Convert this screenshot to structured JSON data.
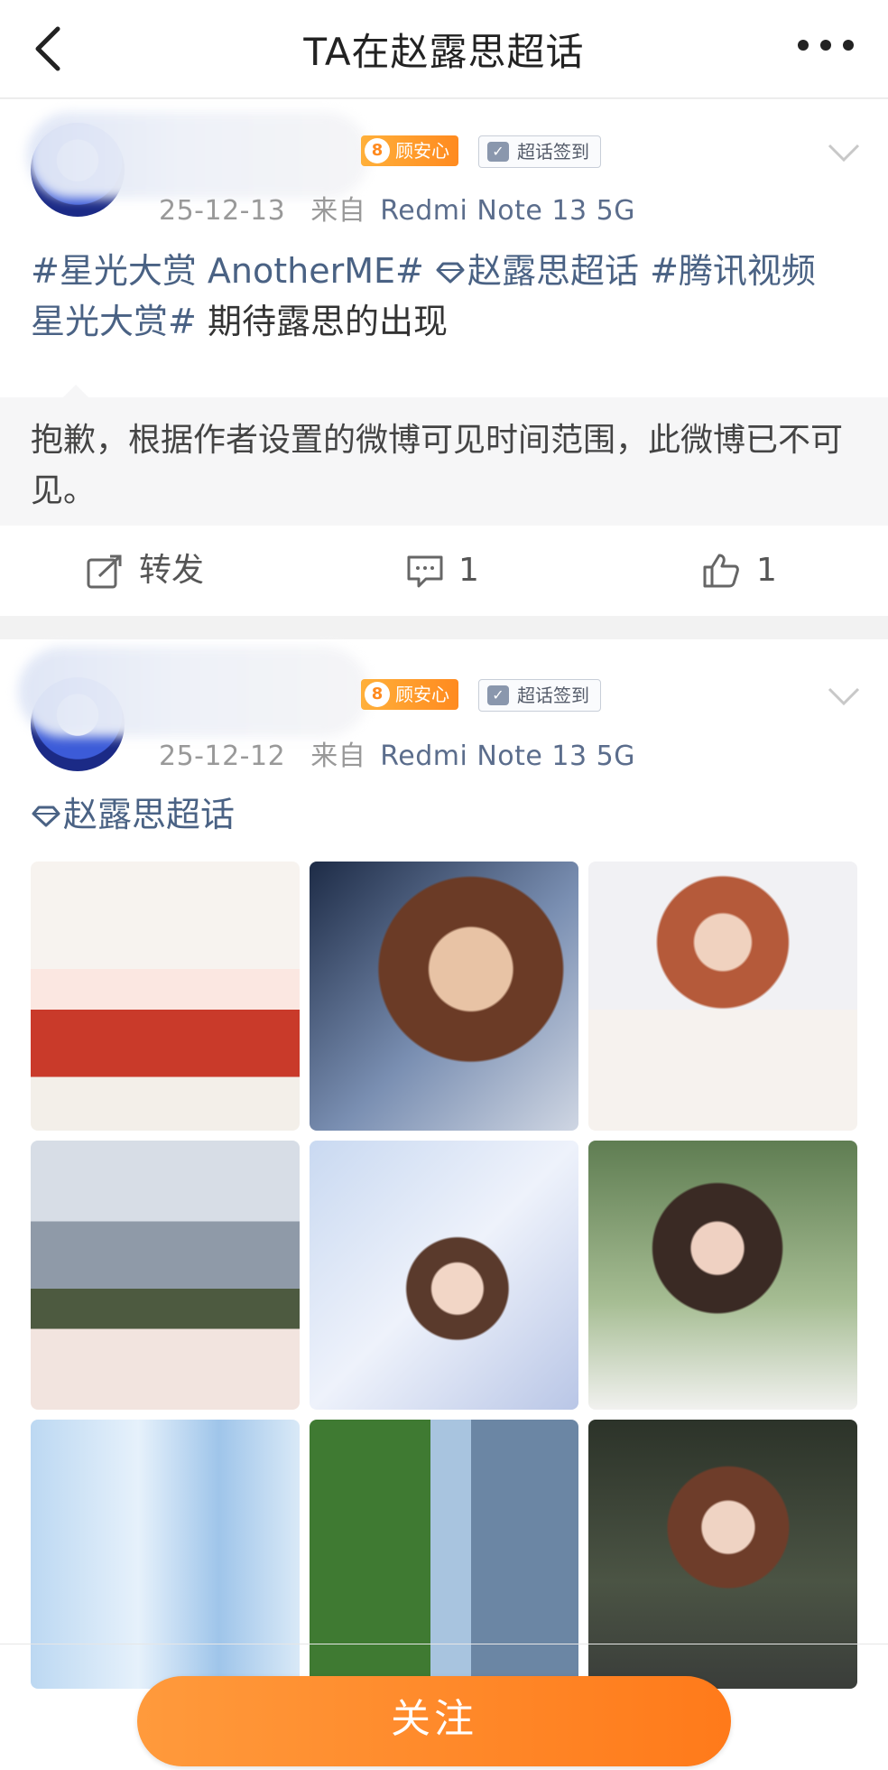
{
  "header": {
    "title": "TA在赵露思超话"
  },
  "posts": [
    {
      "level": "8",
      "fan_badge": "顾安心",
      "sign_badge": "超话签到",
      "date": "25-12-13",
      "source_prefix": "来自",
      "device": "Redmi Note 13 5G",
      "tags": [
        "#星光大赏 AnotherME#",
        "赵露思超话",
        "#腾讯视频",
        "星光大赏#"
      ],
      "text": "期待露思的出现",
      "notice": "抱歉，根据作者设置的微博可见时间范围，此微博已不可见。",
      "actions": {
        "repost": "转发",
        "comments": "1",
        "likes": "1"
      }
    },
    {
      "level": "8",
      "fan_badge": "顾安心",
      "sign_badge": "超话签到",
      "date": "25-12-12",
      "source_prefix": "来自",
      "device": "Redmi Note 13 5G",
      "topic": "赵露思超话",
      "images": [
        {
          "name": "photo-red-sweater-handbag"
        },
        {
          "name": "photo-headphones-portrait"
        },
        {
          "name": "photo-cafe-dessert"
        },
        {
          "name": "photo-castle-bunny"
        },
        {
          "name": "photo-flowers-visor"
        },
        {
          "name": "photo-garden-portrait"
        },
        {
          "name": "photo-curtain-light"
        },
        {
          "name": "photo-tree-building"
        },
        {
          "name": "photo-night-street"
        }
      ]
    }
  ],
  "footer": {
    "follow_label": "关注"
  }
}
